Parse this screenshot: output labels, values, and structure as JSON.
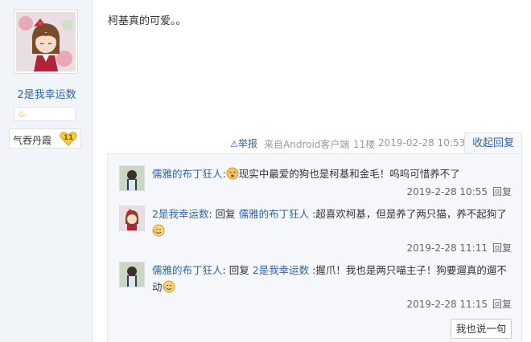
{
  "author": {
    "name": "2是我幸运数",
    "rank_name": "气吞丹霞",
    "rank_level": "11"
  },
  "post": {
    "content": "柯基真的可爱。。",
    "report_label": "举报",
    "source": "来自Android客户端",
    "floor": "11楼",
    "time": "2019-02-28 10:53",
    "collapse_label": "收起回复"
  },
  "comments": [
    {
      "user": "儒雅的布丁狂人",
      "sep": ":",
      "reply_word": "",
      "reply_to": "",
      "reply_sep": "",
      "text": "现实中最爱的狗也是柯基和金毛！呜呜可惜养不了",
      "time": "2019-2-28 10:55",
      "reply_label": "回复"
    },
    {
      "user": "2是我幸运数",
      "sep": ":",
      "reply_word": " 回复 ",
      "reply_to": "儒雅的布丁狂人",
      "reply_sep": " :",
      "text": "超喜欢柯基，但是养了两只猫，养不起狗了",
      "time": "2019-2-28 11:11",
      "reply_label": "回复"
    },
    {
      "user": "儒雅的布丁狂人",
      "sep": ":",
      "reply_word": " 回复 ",
      "reply_to": "2是我幸运数",
      "reply_sep": " :",
      "text": "握爪！我也是两只喵主子！狗要遛真的遛不动",
      "time": "2019-2-28 11:15",
      "reply_label": "回复"
    }
  ],
  "say_button": "我也说一句",
  "colors": {
    "link": "#2d64b3",
    "panel_bg": "#f5f7fa",
    "sidebar_bg": "#f1f4f8"
  },
  "icons": {
    "report": "warning-triangle-icon",
    "level": "flame-icon",
    "rank": "heart-badge-icon",
    "emoji": "smiley-emoji-icon"
  }
}
